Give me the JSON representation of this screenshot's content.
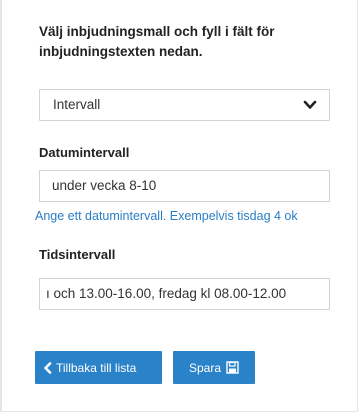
{
  "intro": {
    "line1": "Välj inbjudningsmall och fyll i fält för",
    "line2": "inbjudningstexten nedan."
  },
  "template_select": {
    "value": "Intervall"
  },
  "date_field": {
    "label": "Datumintervall",
    "value": "under vecka 8-10",
    "hint": "Ange ett datumintervall. Exempelvis tisdag 4 ok"
  },
  "time_field": {
    "label": "Tidsintervall",
    "value": "ı och 13.00-16.00, fredag kl 08.00-12.00"
  },
  "buttons": {
    "back_label": "Tillbaka till lista",
    "save_label": "Spara"
  },
  "colors": {
    "accent": "#2a82c9",
    "hint_text": "#2a7ec6"
  },
  "icons": {
    "back": "chevron-left-icon",
    "save": "floppy-disk-icon",
    "select": "chevron-down-icon"
  }
}
